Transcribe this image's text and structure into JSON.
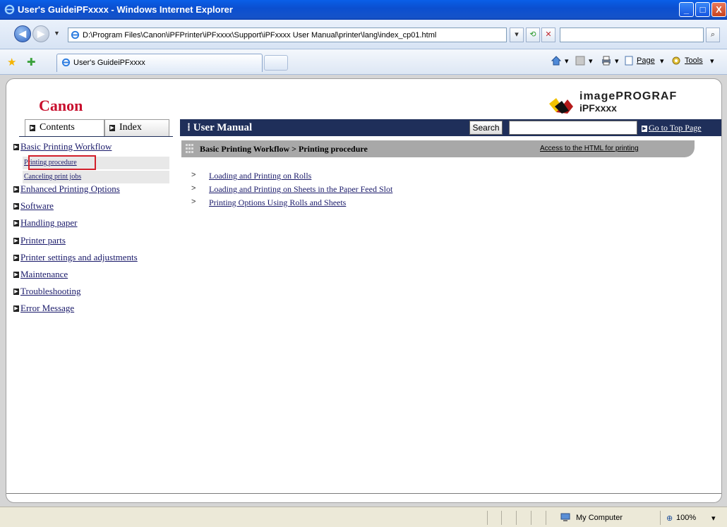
{
  "window": {
    "title": "User's GuideiPFxxxx - Windows Internet Explorer",
    "minimize": "_",
    "maximize": "□",
    "close": "X"
  },
  "address": {
    "url": "D:\\Program Files\\Canon\\iPFPrinter\\iPFxxxx\\Support\\iPFxxxx User Manual\\printer\\lang\\index_cp01.html",
    "refresh_icon": "refresh-icon",
    "stop_icon": "stop-icon",
    "search_placeholder": ""
  },
  "tabs": {
    "active_label": "User's GuideiPFxxxx"
  },
  "commandbar": {
    "page_label": "Page",
    "tools_label": "Tools"
  },
  "page": {
    "brand": "Canon",
    "product_line": "imagePROGRAF",
    "product_model": "iPFxxxx",
    "contents_tab": "Contents",
    "index_tab": "Index",
    "header_title": "User Manual",
    "search_button": "Search",
    "search_value": "",
    "top_page_link": "Go to Top Page",
    "breadcrumb": "Basic Printing Workflow > Printing procedure",
    "print_link": "Access to the HTML for printing",
    "nav": [
      {
        "label": "Basic Printing Workflow"
      },
      {
        "label": "Enhanced Printing Options"
      },
      {
        "label": "Software"
      },
      {
        "label": "Handling paper"
      },
      {
        "label": "Printer parts"
      },
      {
        "label": "Printer settings and adjustments"
      },
      {
        "label": "Maintenance"
      },
      {
        "label": "Troubleshooting"
      },
      {
        "label": "Error Message"
      }
    ],
    "subnav": [
      {
        "label": "Printing procedure",
        "selected": true
      },
      {
        "label": "Canceling print jobs",
        "selected": false
      }
    ],
    "topics": [
      {
        "label": "Loading and Printing on Rolls"
      },
      {
        "label": "Loading and Printing on Sheets in the Paper Feed Slot"
      },
      {
        "label": "Printing Options Using Rolls and Sheets"
      }
    ]
  },
  "status": {
    "zone": "My Computer",
    "zoom": "100%"
  },
  "colors": {
    "accent_navy": "#1f2f5a",
    "canon_red": "#c8102e",
    "highlight_red": "#d21f2a"
  }
}
